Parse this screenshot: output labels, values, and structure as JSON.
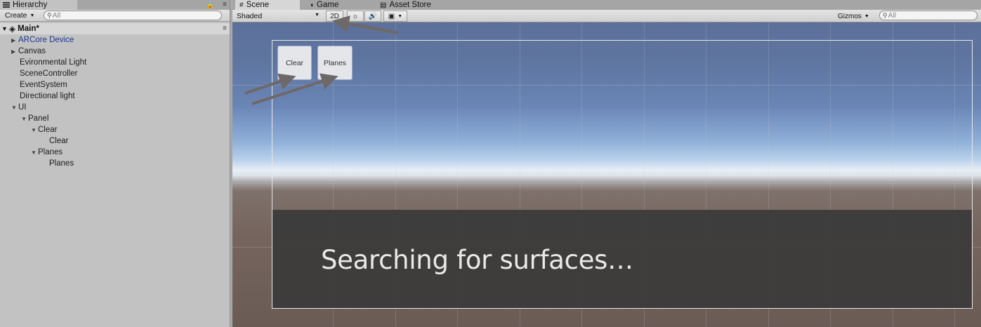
{
  "hierarchy": {
    "tab_label": "Hierarchy",
    "create_label": "Create",
    "search_placeholder": "All",
    "scene_name": "Main*",
    "items": [
      {
        "label": "ARCore Device",
        "expandable": true
      },
      {
        "label": "Canvas",
        "expandable": true
      },
      {
        "label": "Evironmental Light",
        "expandable": false
      },
      {
        "label": "SceneController",
        "expandable": false
      },
      {
        "label": "EventSystem",
        "expandable": false
      },
      {
        "label": "Directional light",
        "expandable": false
      },
      {
        "label": "UI",
        "expanded": true
      },
      {
        "label": "Panel",
        "expanded": true
      },
      {
        "label": "Clear",
        "expanded": true
      },
      {
        "label": "Clear",
        "expandable": false
      },
      {
        "label": "Planes",
        "expanded": true
      },
      {
        "label": "Planes",
        "expandable": false
      }
    ]
  },
  "scene": {
    "tabs": [
      {
        "label": "Scene",
        "icon": "grid-icon",
        "active": true
      },
      {
        "label": "Game",
        "icon": "pacman-icon",
        "active": false
      },
      {
        "label": "Asset Store",
        "icon": "store-icon",
        "active": false
      }
    ],
    "toolbar": {
      "shading_mode": "Shaded",
      "mode_2d_label": "2D",
      "gizmos_label": "Gizmos",
      "search_placeholder": "All"
    },
    "viewport": {
      "buttons": [
        "Clear",
        "Planes"
      ],
      "status_text": "Searching for surfaces…"
    }
  },
  "colors": {
    "sky_top": "#5c7099",
    "horizon": "#e6eef6",
    "ground": "#75655e",
    "panel_overlay": "#3a3a3a",
    "arrow": "#6e6868"
  }
}
